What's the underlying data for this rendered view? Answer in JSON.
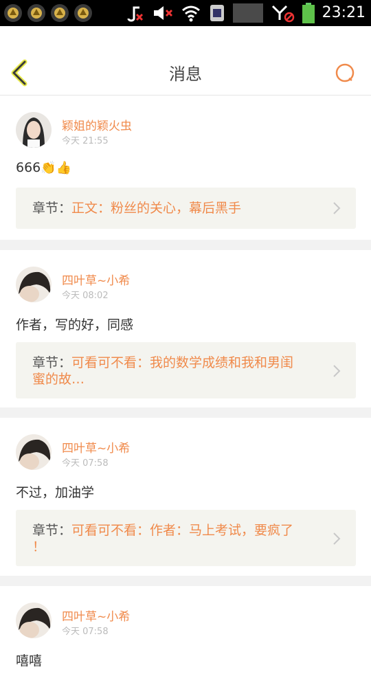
{
  "status_bar": {
    "time": "23:21",
    "notification_icons": [
      "app-notification-icon",
      "app-notification-icon",
      "app-notification-icon",
      "app-notification-icon"
    ],
    "system_icons": [
      "music-muted-icon",
      "volume-muted-icon",
      "wifi-icon",
      "sim-icon",
      "signal-icon",
      "data-disabled-icon",
      "battery-icon"
    ]
  },
  "header": {
    "title": "消息"
  },
  "colors": {
    "accent": "#f08a4b",
    "text": "#333333",
    "muted": "#bbbbbb",
    "chapter_bg": "#f4f4ef",
    "separator": "#f2f2f2"
  },
  "messages": [
    {
      "name": "颖姐的颖火虫",
      "time": "今天 21:55",
      "content": "666",
      "content_emoji": "👏👍",
      "chapter_label": "章节：",
      "chapter_line1": "正文：粉丝的关心，幕后黑手",
      "chapter_line2": ""
    },
    {
      "name": "四叶草~小希",
      "time": "今天 08:02",
      "content": "作者，写的好，同感",
      "content_emoji": "",
      "chapter_label": "章节：",
      "chapter_line1": "可看可不看：我的数学成绩和我和男闺",
      "chapter_line2": "蜜的故…"
    },
    {
      "name": "四叶草~小希",
      "time": "今天 07:58",
      "content": "不过，加油学",
      "content_emoji": "",
      "chapter_label": "章节：",
      "chapter_line1": "可看可不看：作者：马上考试，要疯了",
      "chapter_line2": "！"
    },
    {
      "name": "四叶草~小希",
      "time": "今天 07:58",
      "content": "嘻嘻",
      "content_emoji": "",
      "chapter_label": "",
      "chapter_line1": "",
      "chapter_line2": ""
    }
  ]
}
